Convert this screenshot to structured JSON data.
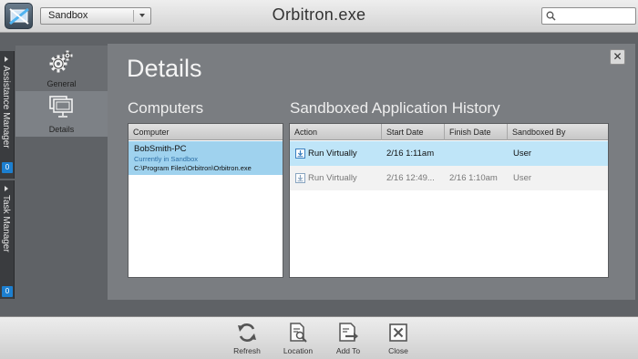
{
  "window": {
    "title": "Orbitron.exe"
  },
  "environment_select": {
    "value": "Sandbox"
  },
  "search": {
    "placeholder": ""
  },
  "side_tabs": [
    {
      "label": "Assistance Manager",
      "badge": "0"
    },
    {
      "label": "Task Manager",
      "badge": "0"
    }
  ],
  "nav": {
    "items": [
      {
        "label": "General",
        "icon": "gear-icon"
      },
      {
        "label": "Details",
        "icon": "monitor-windows-icon",
        "selected": true
      }
    ]
  },
  "panel": {
    "title": "Details",
    "close_label": "✕",
    "computers": {
      "title": "Computers",
      "column": "Computer",
      "rows": [
        {
          "name": "BobSmith-PC",
          "status": "Currently in Sandbox",
          "path": "C:\\Program Files\\Orbitron\\Orbitron.exe"
        }
      ]
    },
    "history": {
      "title": "Sandboxed Application History",
      "columns": [
        "Action",
        "Start Date",
        "Finish Date",
        "Sandboxed By"
      ],
      "rows": [
        {
          "action": "Run Virtually",
          "start": "2/16 1:11am",
          "finish": "",
          "by": "User"
        },
        {
          "action": "Run Virtually",
          "start": "2/16 12:49...",
          "finish": "2/16 1:10am",
          "by": "User"
        }
      ]
    }
  },
  "toolbar": {
    "buttons": [
      {
        "label": "Refresh",
        "icon": "refresh-icon"
      },
      {
        "label": "Location",
        "icon": "location-document-icon"
      },
      {
        "label": "Add To",
        "icon": "add-to-icon"
      },
      {
        "label": "Close",
        "icon": "close-box-icon"
      }
    ]
  },
  "colors": {
    "selected_row": "#9fd2ee",
    "panel_bg": "#7a7d81",
    "badge": "#1c7fd0"
  }
}
